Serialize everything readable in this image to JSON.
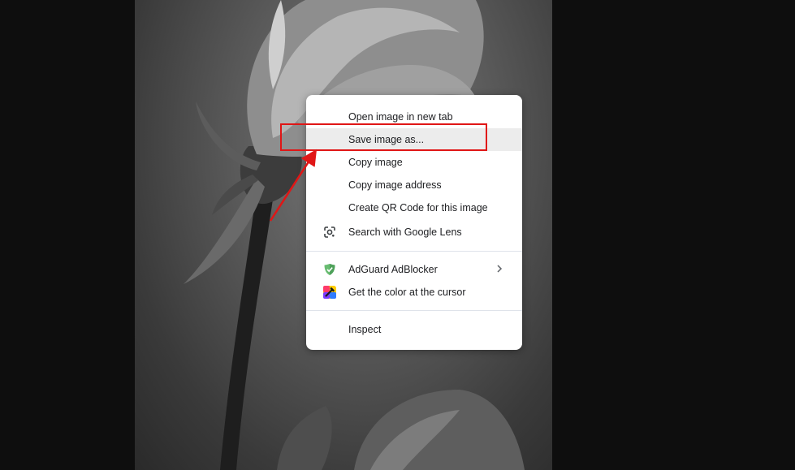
{
  "context_menu": {
    "items": [
      {
        "label": "Open image in new tab"
      },
      {
        "label": "Save image as..."
      },
      {
        "label": "Copy image"
      },
      {
        "label": "Copy image address"
      },
      {
        "label": "Create QR Code for this image"
      },
      {
        "label": "Search with Google Lens",
        "icon": "google-lens-icon"
      },
      {
        "label": "AdGuard AdBlocker",
        "icon": "adguard-shield-icon",
        "submenu": true
      },
      {
        "label": "Get the color at the cursor",
        "icon": "color-picker-icon"
      },
      {
        "label": "Inspect"
      }
    ],
    "highlighted_index": 1
  },
  "annotation": {
    "color": "#e01616"
  }
}
